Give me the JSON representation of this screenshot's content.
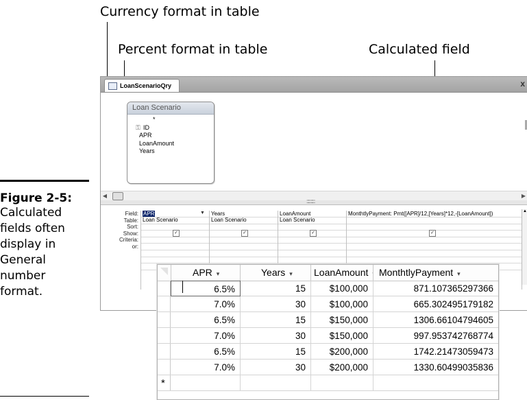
{
  "callouts": {
    "currency": "Currency format in table",
    "percent": "Percent format in table",
    "calculated": "Calculated field"
  },
  "caption": {
    "figure": "Figure 2-5:",
    "lines": [
      "Calculated",
      "fields often",
      "display in",
      "General",
      "number",
      "format."
    ]
  },
  "window": {
    "tab_title": "LoanScenarioQry",
    "close_glyph": "x"
  },
  "design": {
    "table_title": "Loan Scenario",
    "fields": [
      "*",
      "ID",
      "APR",
      "LoanAmount",
      "Years"
    ]
  },
  "grid": {
    "row_labels": [
      "Field:",
      "Table:",
      "Sort:",
      "Show:",
      "Criteria:",
      "or:"
    ],
    "columns": [
      {
        "field": "APR",
        "table": "Loan Scenario",
        "show": true
      },
      {
        "field": "Years",
        "table": "Loan Scenario",
        "show": true
      },
      {
        "field": "LoanAmount",
        "table": "Loan Scenario",
        "show": true
      },
      {
        "field": "MonthtlyPayment: Pmt([APR]/12,[Years]*12,-[LoanAmount])",
        "table": "",
        "show": true
      }
    ]
  },
  "datasheet": {
    "headers": [
      "APR",
      "Years",
      "LoanAmount",
      "MonthtlyPayment"
    ],
    "header_arrow": "▾",
    "rows": [
      {
        "apr": "6.5%",
        "years": "15",
        "amount": "$100,000",
        "payment": "871.107365297366"
      },
      {
        "apr": "7.0%",
        "years": "30",
        "amount": "$100,000",
        "payment": "665.302495179182"
      },
      {
        "apr": "6.5%",
        "years": "15",
        "amount": "$150,000",
        "payment": "1306.66104794605"
      },
      {
        "apr": "7.0%",
        "years": "30",
        "amount": "$150,000",
        "payment": "997.953742768774"
      },
      {
        "apr": "6.5%",
        "years": "15",
        "amount": "$200,000",
        "payment": "1742.21473059473"
      },
      {
        "apr": "7.0%",
        "years": "30",
        "amount": "$200,000",
        "payment": "1330.60499035836"
      }
    ],
    "new_row_marker": "*"
  },
  "icons": {
    "key": "key-icon",
    "check": "✓"
  }
}
